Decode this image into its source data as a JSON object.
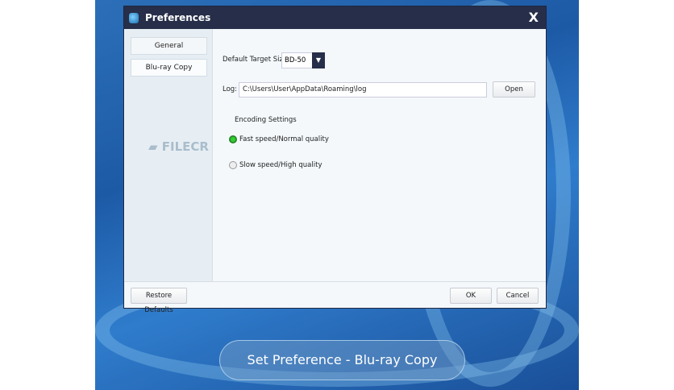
{
  "dialog": {
    "title": "Preferences",
    "close": "X"
  },
  "sidebar": {
    "tabs": [
      {
        "label": "General"
      },
      {
        "label": "Blu-ray Copy"
      }
    ]
  },
  "main": {
    "target_label": "Default Target Size:",
    "target_value": "BD-50",
    "log_label": "Log:",
    "log_value": "C:\\Users\\User\\AppData\\Roaming\\log",
    "open_button": "Open",
    "encoding_heading": "Encoding Settings",
    "options": [
      {
        "label": "Fast speed/Normal quality",
        "selected": true
      },
      {
        "label": "Slow speed/High quality",
        "selected": false
      }
    ]
  },
  "footer": {
    "restore": "Restore Defaults",
    "ok": "OK",
    "cancel": "Cancel"
  },
  "watermark": "FILECR",
  "caption": "Set Preference - Blu-ray Copy"
}
